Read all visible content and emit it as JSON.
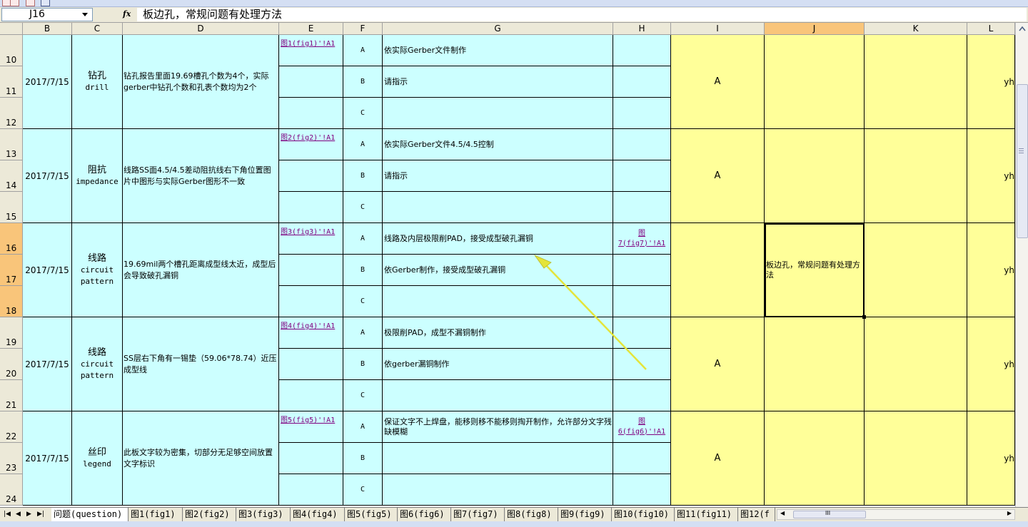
{
  "name_box": "J16",
  "fx_label": "fx",
  "formula_content": "板边孔，常规问题有处理方法",
  "columns": [
    "B",
    "C",
    "D",
    "E",
    "F",
    "G",
    "H",
    "I",
    "J",
    "K",
    "L"
  ],
  "rows": [
    "10",
    "11",
    "12",
    "13",
    "14",
    "15",
    "16",
    "17",
    "18",
    "19",
    "20",
    "21",
    "22",
    "23",
    "24"
  ],
  "groups": [
    {
      "date": "2017/7/15",
      "proc_zh": "钻孔",
      "proc_en": [
        "drill"
      ],
      "desc": "钻孔报告里面19.69槽孔个数为4个，实际gerber中钻孔个数和孔表个数均为2个",
      "link": "图1(fig1)'!A1",
      "h_link": [
        "",
        ""
      ],
      "resp": "A",
      "person": "yh",
      "j_note": "",
      "options": [
        "A",
        "B",
        "C"
      ],
      "solutions": [
        "依实际Gerber文件制作",
        "请指示",
        ""
      ]
    },
    {
      "date": "2017/7/15",
      "proc_zh": "阻抗",
      "proc_en": [
        "impedance"
      ],
      "desc": "线路SS面4.5/4.5差动阻抗线右下角位置图片中图形与实际Gerber图形不一致",
      "link": "图2(fig2)'!A1",
      "h_link": [
        "",
        ""
      ],
      "resp": "A",
      "person": "yh",
      "j_note": "",
      "options": [
        "A",
        "B",
        "C"
      ],
      "solutions": [
        "依实际Gerber文件4.5/4.5控制",
        "请指示",
        ""
      ]
    },
    {
      "date": "2017/7/15",
      "proc_zh": "线路",
      "proc_en": [
        "circuit",
        "pattern"
      ],
      "desc": "19.69mil两个槽孔距离成型线太近，成型后会导致破孔漏铜",
      "link": "图3(fig3)'!A1",
      "h_link": [
        "图",
        "7(fig7)'!A1"
      ],
      "resp": "",
      "person": "yh",
      "j_note": "板边孔，常规问题有处理方法",
      "options": [
        "A",
        "B",
        "C"
      ],
      "solutions": [
        "线路及内层极限削PAD，接受成型破孔漏铜",
        "依Gerber制作，接受成型破孔漏铜",
        ""
      ]
    },
    {
      "date": "2017/7/15",
      "proc_zh": "线路",
      "proc_en": [
        "circuit",
        "pattern"
      ],
      "desc": "SS层右下角有一锡垫（59.06*78.74）近压成型线",
      "link": "图4(fig4)'!A1",
      "h_link": [
        "",
        ""
      ],
      "resp": "A",
      "person": "yh",
      "j_note": "",
      "options": [
        "A",
        "B",
        "C"
      ],
      "solutions": [
        "极限削PAD，成型不漏铜制作",
        "依gerber漏铜制作",
        ""
      ]
    },
    {
      "date": "2017/7/15",
      "proc_zh": "丝印",
      "proc_en": [
        "legend"
      ],
      "desc": "此板文字较为密集，切部分无足够空间放置文字标识",
      "link": "图5(fig5)'!A1",
      "h_link": [
        "图",
        "6(fig6)'!A1"
      ],
      "resp": "A",
      "person": "yh",
      "j_note": "",
      "options": [
        "A",
        "B",
        "C"
      ],
      "solutions": [
        "保证文字不上焊盘，能移则移不能移则掏开制作，允许部分文字残缺模糊",
        "",
        ""
      ]
    }
  ],
  "sheet_tabs": [
    "问题(question)",
    "图1(fig1)",
    "图2(fig2)",
    "图3(fig3)",
    "图4(fig4)",
    "图5(fig5)",
    "图6(fig6)",
    "图7(fig7)",
    "图8(fig8)",
    "图9(fig9)",
    "图10(fig10)",
    "图11(fig11)",
    "图12(f"
  ],
  "scroll_grip": "III",
  "colors": {
    "cyan": "#ccffff",
    "yellow": "#ffff99",
    "selected_header": "#f9c57a",
    "arrow": "#e4e43a"
  }
}
